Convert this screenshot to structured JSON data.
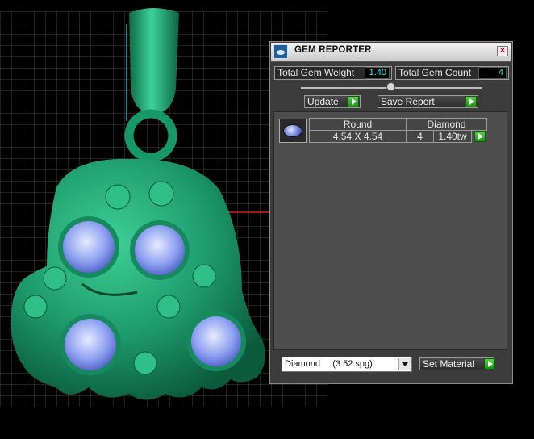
{
  "window": {
    "title": "GEM REPORTER",
    "close_glyph": "✕",
    "icon": "gem-reporter-app-icon"
  },
  "summary": {
    "total_weight_label": "Total Gem Weight",
    "total_weight_value": "1.40",
    "total_count_label": "Total Gem Count",
    "total_count_value": "4"
  },
  "toolbar": {
    "update_label": "Update",
    "save_report_label": "Save Report"
  },
  "gem_list": {
    "rows": [
      {
        "shape": "Round",
        "size": "4.54 X 4.54",
        "material": "Diamond",
        "count": "4",
        "weight": "1.40tw"
      }
    ]
  },
  "material": {
    "selected": "Diamond     (3.52 spg)",
    "set_label": "Set Material"
  },
  "colors": {
    "panel_bg": "#3c3c3c",
    "value_text": "#2fe3e3",
    "accent_green": "#2fae2a",
    "model_green": "#1f9a6e",
    "gem_blue": "#7d8fe8"
  }
}
